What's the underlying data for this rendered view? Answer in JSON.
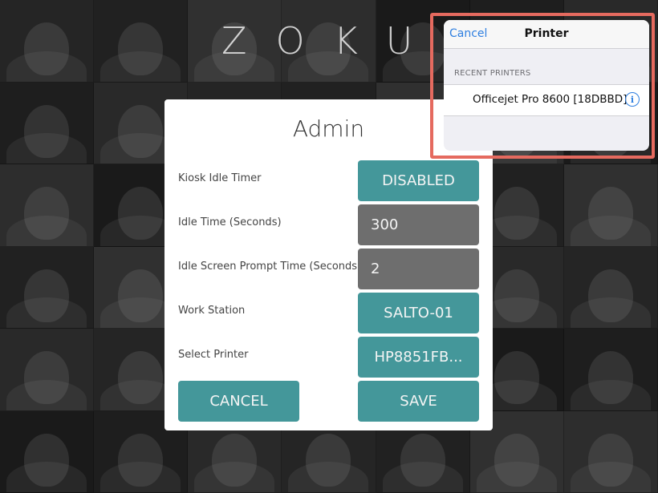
{
  "logo": {
    "text": "ZOKU"
  },
  "admin": {
    "title": "Admin",
    "rows": [
      {
        "label": "Kiosk Idle Timer",
        "value": "DISABLED"
      },
      {
        "label": "Idle Time (Seconds)",
        "value": "300"
      },
      {
        "label": "Idle Screen Prompt Time (Seconds)",
        "value": "2"
      },
      {
        "label": "Work Station",
        "value": "SALTO-01"
      },
      {
        "label": "Select Printer",
        "value": "HP8851FB..."
      }
    ],
    "cancel_label": "CANCEL",
    "save_label": "SAVE"
  },
  "printer_popover": {
    "cancel_label": "Cancel",
    "title": "Printer",
    "section_label": "RECENT PRINTERS",
    "printers": [
      {
        "name": "Officejet Pro 8600 [18DBBD]",
        "icon": "info-icon"
      }
    ]
  },
  "colors": {
    "teal": "#44979a",
    "gray_field": "#6e6e6e",
    "highlight": "#e56a5f",
    "ios_blue": "#2f7fe0"
  }
}
